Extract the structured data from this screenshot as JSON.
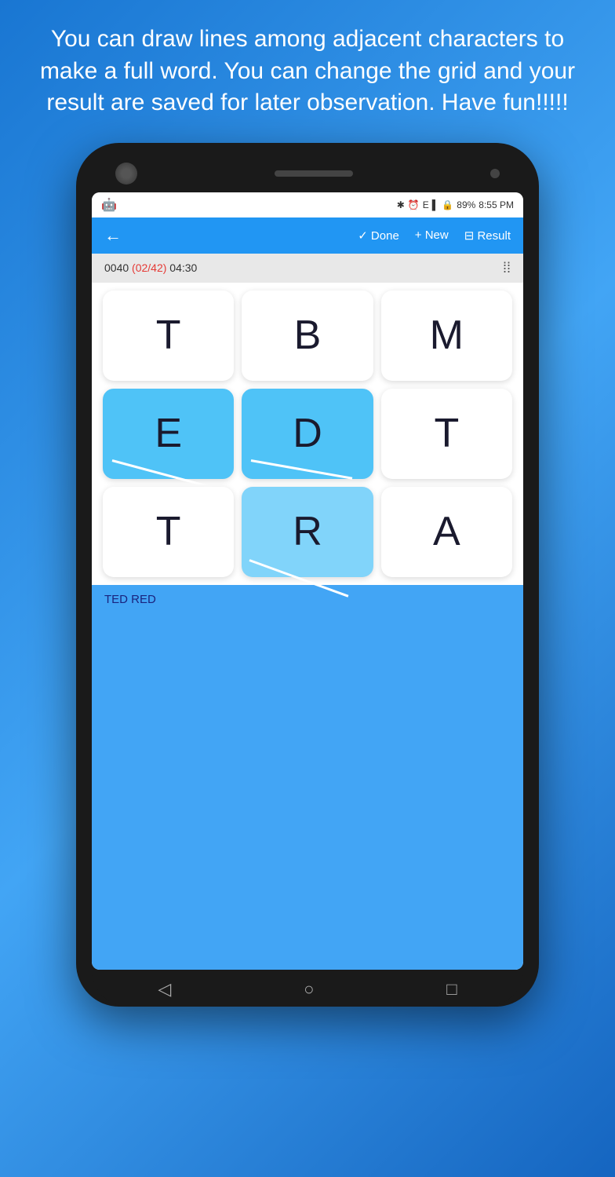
{
  "header": {
    "description": "You can draw lines among adjacent characters to make a full word. You can change the grid and your result are saved for later observation. Have fun!!!!!"
  },
  "status_bar": {
    "android_icon": "🤖",
    "bluetooth": "✱",
    "alarm": "⏰",
    "signal": "E",
    "lock": "?",
    "battery": "89%",
    "time": "8:55 PM"
  },
  "toolbar": {
    "back_label": "←",
    "done_label": "✓ Done",
    "new_label": "+ New",
    "result_label": "⊟ Result"
  },
  "game_info": {
    "counter": "0040",
    "progress": "(02/42)",
    "timer": "04:30"
  },
  "grid": {
    "cells": [
      {
        "letter": "T",
        "active": false,
        "row": 0,
        "col": 0
      },
      {
        "letter": "B",
        "active": false,
        "row": 0,
        "col": 1
      },
      {
        "letter": "M",
        "active": false,
        "row": 0,
        "col": 2
      },
      {
        "letter": "E",
        "active": true,
        "row": 1,
        "col": 0
      },
      {
        "letter": "D",
        "active": true,
        "row": 1,
        "col": 1
      },
      {
        "letter": "T",
        "active": false,
        "row": 1,
        "col": 2
      },
      {
        "letter": "T",
        "active": false,
        "row": 2,
        "col": 0
      },
      {
        "letter": "R",
        "active": true,
        "row": 2,
        "col": 1
      },
      {
        "letter": "A",
        "active": false,
        "row": 2,
        "col": 2
      }
    ]
  },
  "found_words": {
    "words": "TED   RED"
  },
  "phone_nav": {
    "back": "◁",
    "home": "○",
    "recents": "□"
  }
}
